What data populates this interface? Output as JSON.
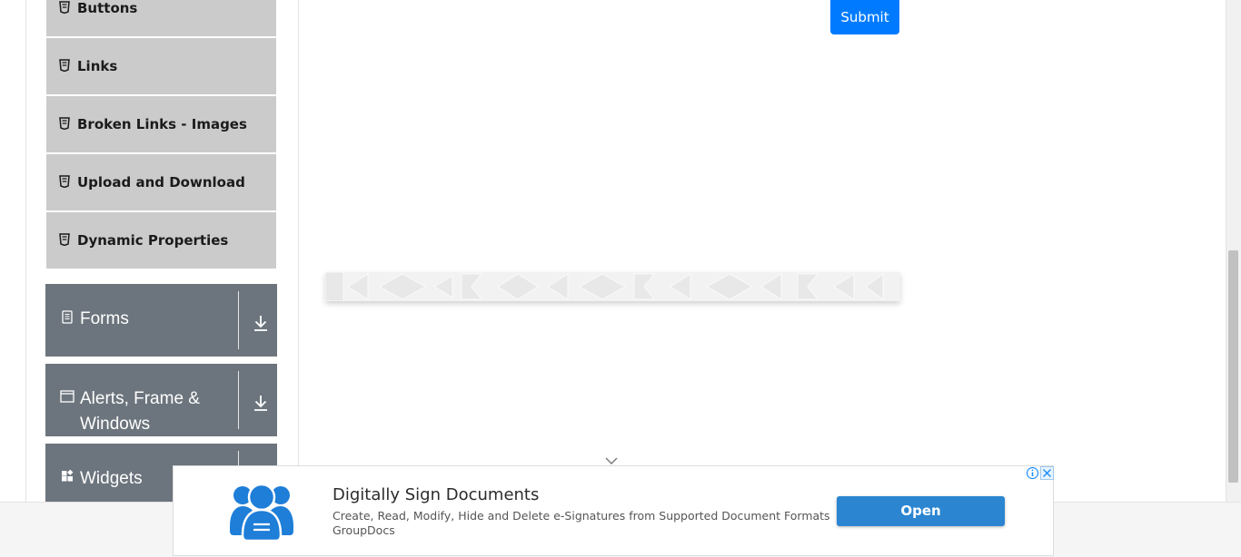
{
  "sidebar": {
    "elements_items": [
      {
        "label": "Buttons"
      },
      {
        "label": "Links"
      },
      {
        "label": "Broken Links - Images"
      },
      {
        "label": "Upload and Download"
      },
      {
        "label": "Dynamic Properties"
      }
    ],
    "groups": {
      "forms": {
        "title": "Forms"
      },
      "alerts": {
        "title": "Alerts, Frame & Windows"
      },
      "widgets": {
        "title": "Widgets"
      }
    }
  },
  "main": {
    "submit_label": "Submit"
  },
  "ad": {
    "title": "Digitally Sign Documents",
    "description": "Create, Read, Modify, Hide and Delete e-Signatures from Supported Document Formats",
    "brand": "GroupDocs",
    "open_label": "Open"
  },
  "colors": {
    "primary": "#007bff",
    "group_bg": "#6c757d",
    "item_bg": "#cbcbcb",
    "ad_button": "#2b85d1"
  }
}
